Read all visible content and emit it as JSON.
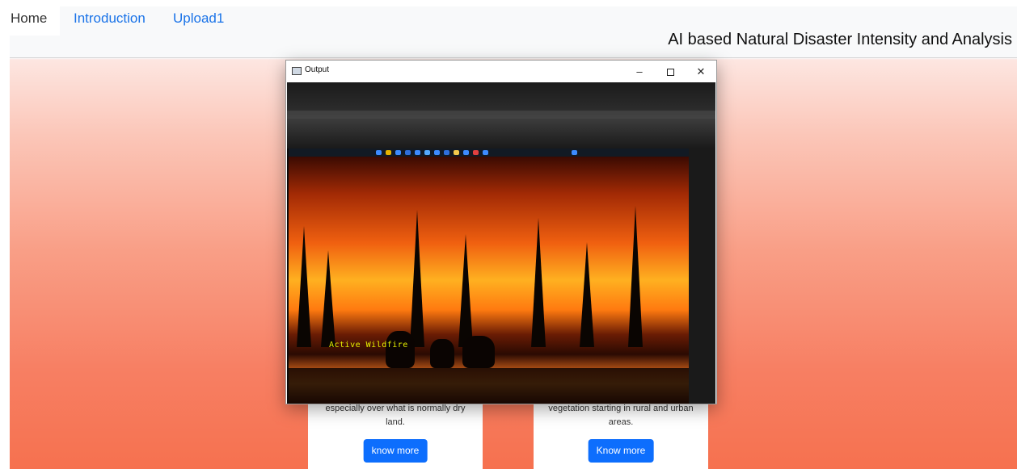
{
  "nav": {
    "tabs": [
      {
        "label": "Home",
        "active": true
      },
      {
        "label": "Introduction",
        "active": false
      },
      {
        "label": "Upload1",
        "active": false
      }
    ],
    "site_title": "AI based Natural Disaster Intensity and Analysis"
  },
  "cards": [
    {
      "text": "especially over what is normally dry land.",
      "button": "know more"
    },
    {
      "text": "vegetation starting in rural and urban areas.",
      "button": "Know more"
    }
  ],
  "output_window": {
    "title": "Output",
    "minimize": "–",
    "close": "✕",
    "detection_label": "Active Wildfire"
  },
  "colors": {
    "link": "#1a73e8",
    "button": "#0d6efd",
    "gradient_bottom": "#f6714f"
  }
}
